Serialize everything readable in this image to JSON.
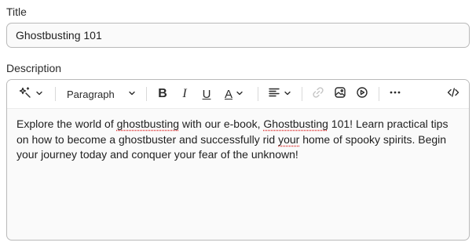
{
  "title_field": {
    "label": "Title",
    "value": "Ghostbusting 101"
  },
  "description_field": {
    "label": "Description"
  },
  "toolbar": {
    "ai_icon": "sparkle-wand-icon",
    "block_type": "Paragraph",
    "bold_label": "B",
    "italic_label": "I",
    "underline_label": "U",
    "text_color_label": "A",
    "more_icon": "ellipsis-icon",
    "code_icon": "code-view-icon"
  },
  "content": {
    "line1_pre": "Explore the world of ",
    "line1_misspelled1": "ghostbusting",
    "line1_mid": " with our e-book, ",
    "line1_misspelled2": "Ghostbusting",
    "line1_post": " 101! Learn practical tips on how to become a ghostbuster and successfully rid ",
    "line2_misspelled": "your",
    "line2_post": " home of spooky spirits. Begin your journey today and conquer your fear of the unknown!"
  },
  "colors": {
    "border": "#b9b9b9",
    "field_bg": "#fafafa",
    "spellcheck": "#dd3333",
    "disabled_icon": "#c4c4c4"
  }
}
